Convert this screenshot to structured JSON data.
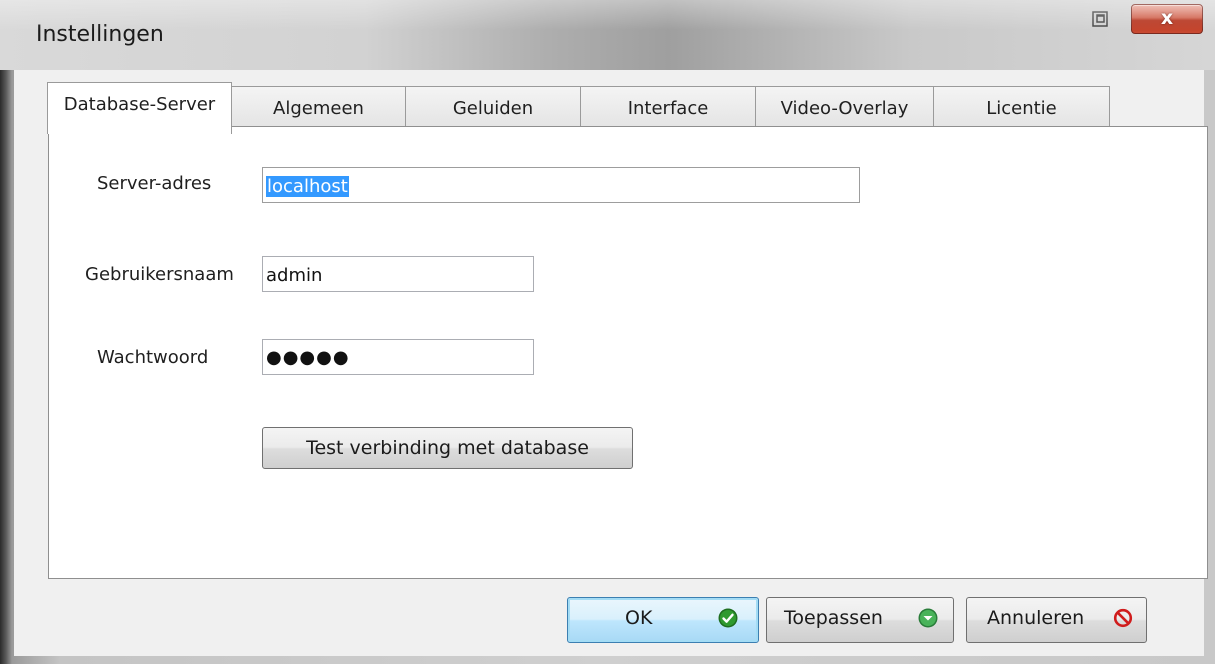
{
  "window": {
    "title": "Instellingen",
    "close_glyph": "x"
  },
  "tabs": [
    {
      "label": "Database-Server",
      "active": true
    },
    {
      "label": "Algemeen",
      "active": false
    },
    {
      "label": "Geluiden",
      "active": false
    },
    {
      "label": "Interface",
      "active": false
    },
    {
      "label": "Video-Overlay",
      "active": false
    },
    {
      "label": "Licentie",
      "active": false
    }
  ],
  "form": {
    "server_label": "Server-adres",
    "server_value": "localhost",
    "username_label": "Gebruikersnaam",
    "username_value": "admin",
    "password_label": "Wachtwoord",
    "password_value": "●●●●●",
    "test_button": "Test verbinding met database"
  },
  "footer": {
    "ok": "OK",
    "apply": "Toepassen",
    "cancel": "Annuleren"
  },
  "icons": {
    "ok_icon": "check-circle",
    "apply_icon": "arrow-down-circle",
    "cancel_icon": "prohibited"
  },
  "colors": {
    "selection": "#3399ff",
    "ok_green": "#2a8a2a",
    "apply_green": "#3aa24c",
    "cancel_red": "#d01c1c"
  }
}
